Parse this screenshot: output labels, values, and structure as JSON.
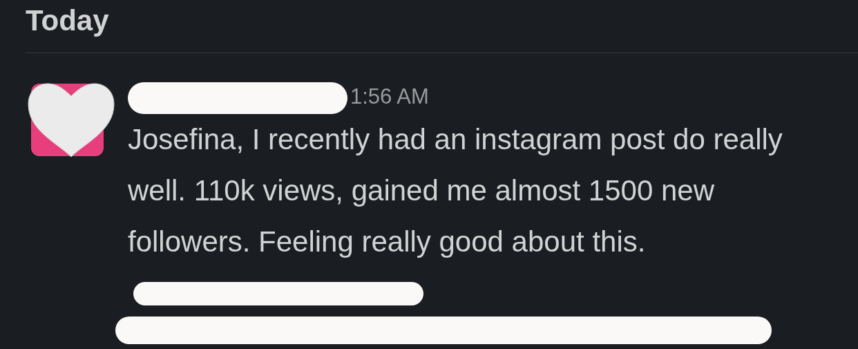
{
  "day_divider": {
    "label": "Today"
  },
  "message": {
    "author_redacted": true,
    "time": "1:56 AM",
    "text": "Josefina, I recently had an instagram post do really well. 110k views, gained me almost 1500 new followers. Feeling really good about this.",
    "text_redacted": true
  }
}
